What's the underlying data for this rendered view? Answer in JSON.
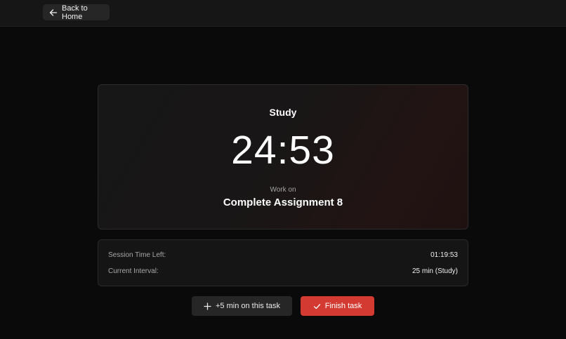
{
  "header": {
    "back_label": "Back to Home",
    "back_icon": "arrow-left-icon"
  },
  "timer": {
    "mode": "Study",
    "time": "24:53",
    "work_on_label": "Work on",
    "task_name": "Complete Assignment 8"
  },
  "session": {
    "time_left_label": "Session Time Left:",
    "time_left_value": "01:19:53",
    "interval_label": "Current Interval:",
    "interval_value": "25 min (Study)"
  },
  "actions": {
    "extend_label": "+5 min on this task",
    "extend_icon": "plus-icon",
    "finish_label": "Finish task",
    "finish_icon": "check-icon"
  },
  "colors": {
    "background": "#0a0a0a",
    "accent": "#d23a32",
    "surface": "#151515"
  }
}
